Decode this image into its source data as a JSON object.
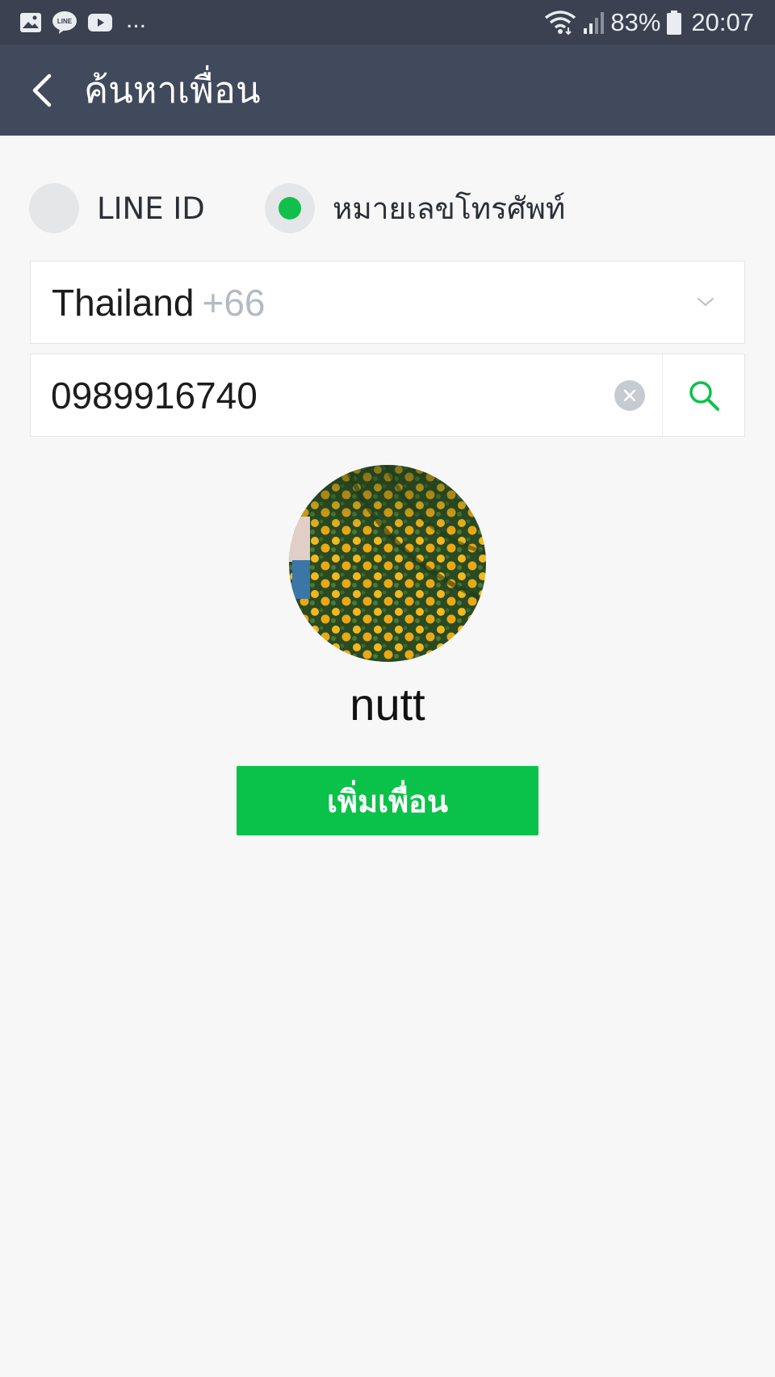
{
  "status_bar": {
    "notification_icons": [
      "gallery-icon",
      "line-icon",
      "youtube-icon"
    ],
    "more_indicator": "...",
    "battery_percent": "83%",
    "time": "20:07"
  },
  "header": {
    "title": "ค้นหาเพื่อน"
  },
  "search_type": {
    "options": [
      {
        "label": "LINE ID",
        "selected": false
      },
      {
        "label": "หมายเลขโทรศัพท์",
        "selected": true
      }
    ]
  },
  "country": {
    "name": "Thailand",
    "code": "+66"
  },
  "phone": {
    "value": "0989916740"
  },
  "result": {
    "name": "nutt",
    "add_button_label": "เพิ่มเพื่อน"
  },
  "colors": {
    "status_bar": "#3b4150",
    "header": "#414a5c",
    "accent_green": "#0ac249",
    "background": "#f7f7f7"
  }
}
